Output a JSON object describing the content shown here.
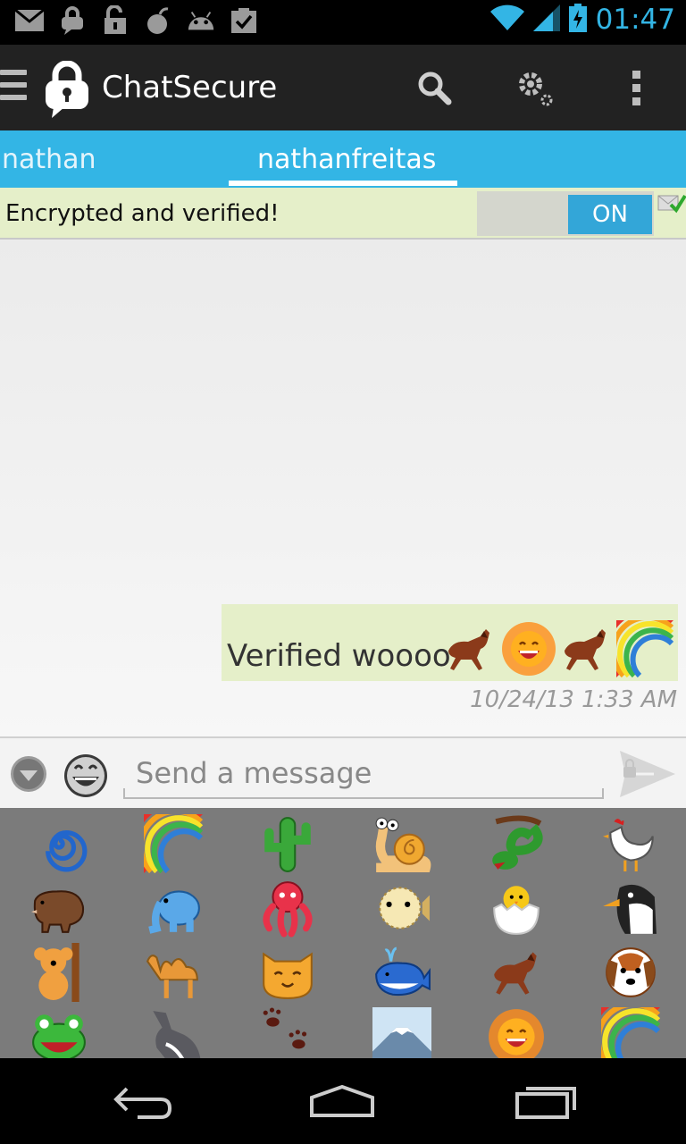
{
  "status_bar": {
    "time": "01:47",
    "left_icons": [
      "mail-icon",
      "lock-bubble-icon",
      "unlock-icon",
      "bomb-icon",
      "android-icon",
      "clipboard-check-icon"
    ],
    "right_icons": [
      "wifi-icon",
      "cell-signal-icon",
      "battery-charging-icon"
    ]
  },
  "action_bar": {
    "title": "ChatSecure",
    "actions": [
      "search-icon",
      "settings-icon",
      "overflow-menu-icon"
    ]
  },
  "tabs": [
    {
      "label": "nathan",
      "active": false
    },
    {
      "label": "nathanfreitas",
      "active": true
    }
  ],
  "encryption": {
    "status_text": "Encrypted and verified!",
    "toggle_label": "ON",
    "toggle_state": "on"
  },
  "conversation": {
    "messages": [
      {
        "text": "Verified woooo",
        "emojis": [
          "horse",
          "sun",
          "horse",
          "rainbow"
        ],
        "timestamp": "10/24/13 1:33 AM",
        "outgoing": true
      }
    ]
  },
  "compose": {
    "placeholder": "Send a message"
  },
  "emoji_panel": {
    "rows": [
      [
        "cyclone",
        "rainbow",
        "cactus",
        "snail",
        "snake",
        "rooster"
      ],
      [
        "boar",
        "elephant",
        "octopus",
        "blowfish",
        "hatching-chick",
        "penguin"
      ],
      [
        "koala",
        "camel",
        "cat",
        "whale",
        "horse",
        "dog"
      ],
      [
        "frog",
        "wolf",
        "paw-prints",
        "mount-fuji",
        "sun",
        "rainbow"
      ]
    ]
  },
  "nav_bar": {
    "buttons": [
      "back-icon",
      "home-icon",
      "recent-apps-icon"
    ]
  },
  "colors": {
    "accent": "#33b5e5",
    "action_bar": "#222222",
    "bubble": "#e5efc9",
    "emoji_panel": "#7b7b7b"
  }
}
